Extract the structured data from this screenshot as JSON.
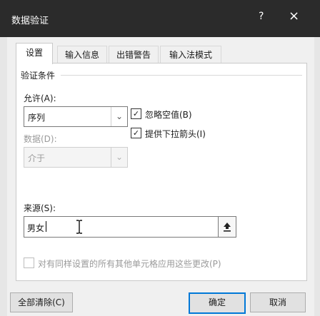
{
  "window": {
    "title": "数据验证",
    "help_label": "?",
    "close_label": "×"
  },
  "tabs": [
    {
      "label": "设置",
      "active": true
    },
    {
      "label": "输入信息",
      "active": false
    },
    {
      "label": "出错警告",
      "active": false
    },
    {
      "label": "输入法模式",
      "active": false
    }
  ],
  "validation": {
    "group_label": "验证条件",
    "allow_label": "允许(A):",
    "allow_value": "序列",
    "data_label": "数据(D):",
    "data_value": "介于",
    "ignore_blank_label": "忽略空值(B)",
    "ignore_blank_checked": true,
    "dropdown_label": "提供下拉箭头(I)",
    "dropdown_checked": true,
    "source_label": "来源(S):",
    "source_value": "男女",
    "apply_all_label": "对有同样设置的所有其他单元格应用这些更改(P)",
    "apply_all_checked": false
  },
  "buttons": {
    "clear_all": "全部清除(C)",
    "ok": "确定",
    "cancel": "取消"
  },
  "icons": {
    "help": "question-icon",
    "close": "close-icon",
    "combo": "chevron-down-icon",
    "check": "check-icon",
    "collapse": "collapse-dialog-icon",
    "cursor": "i-beam-cursor-icon"
  },
  "colors": {
    "titlebar": "#2b2b2b",
    "dialog": "#f0f0f0",
    "primary_border": "#0078d7"
  }
}
